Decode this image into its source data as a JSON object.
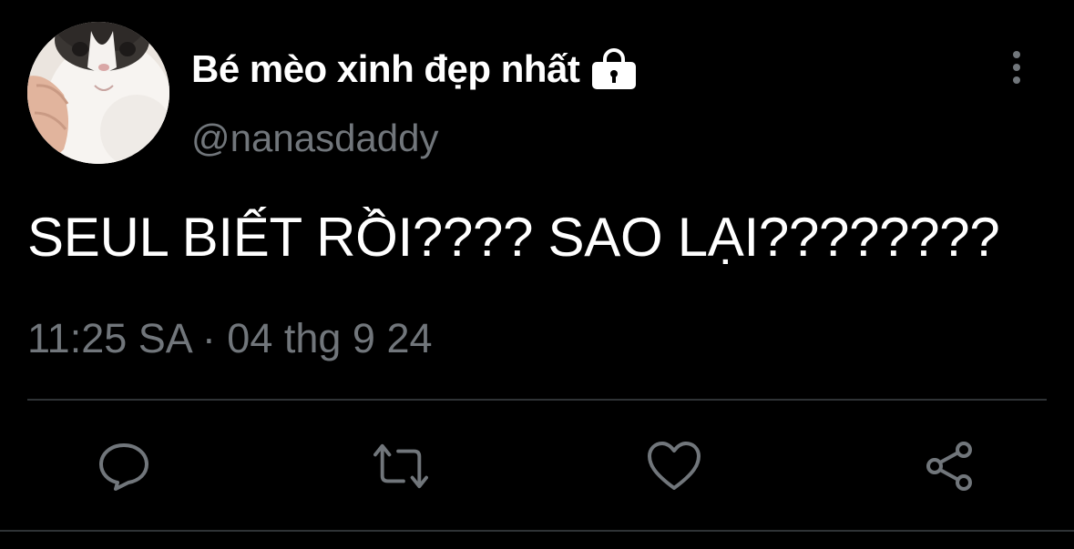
{
  "tweet": {
    "display_name": "Bé mèo xinh đẹp nhất",
    "handle": "@nanasdaddy",
    "text": "SEUL BIẾT RỒI???? SAO LẠI????????",
    "timestamp": "11:25 SA · 04 thg 9 24",
    "protected": true
  },
  "icons": {
    "avatar": "cat-photo-avatar",
    "lock": "lock-icon",
    "more": "more-vertical-icon",
    "reply": "reply-icon",
    "retweet": "retweet-icon",
    "like": "heart-icon",
    "share": "share-icon"
  },
  "colors": {
    "background": "#000000",
    "primary_text": "#ffffff",
    "secondary_text": "#71767b",
    "divider": "#2f3336"
  }
}
